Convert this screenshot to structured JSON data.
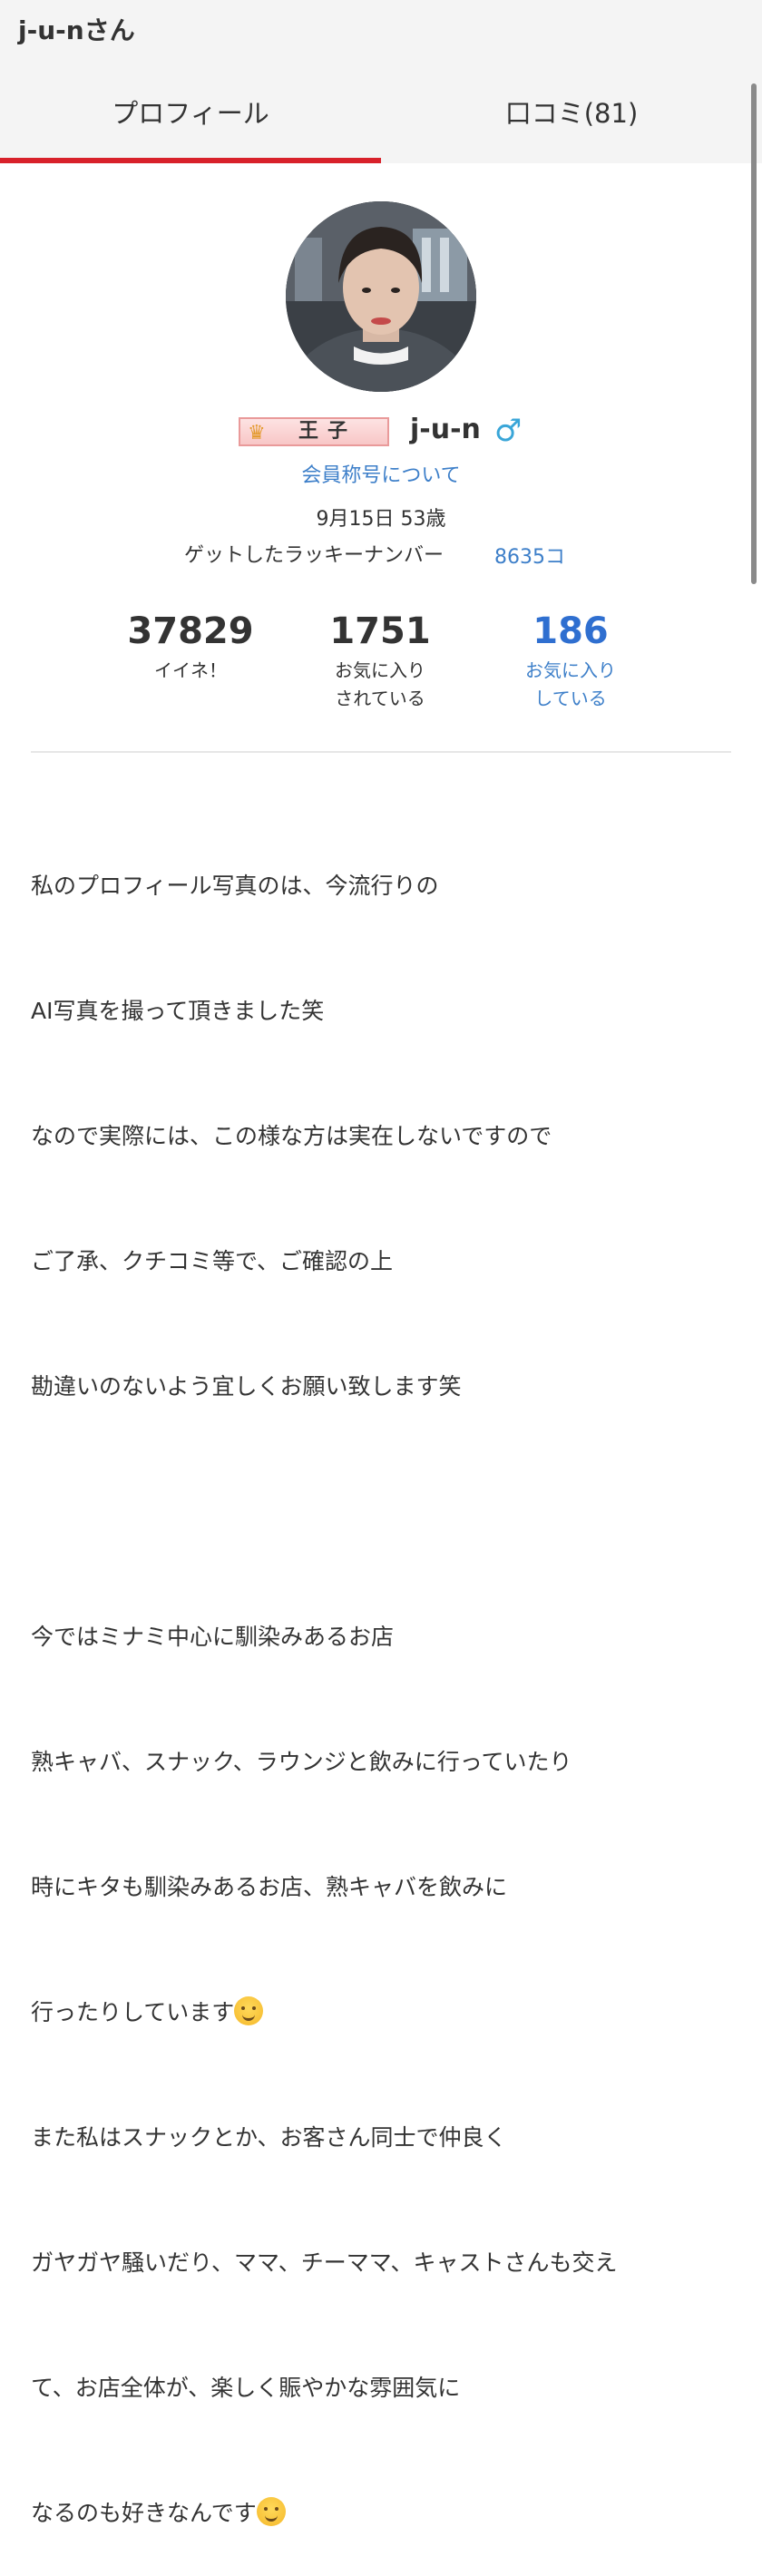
{
  "header": {
    "title": "j-u-nさん"
  },
  "tabs": [
    {
      "label": "プロフィール",
      "active": true
    },
    {
      "label": "口コミ(81)",
      "active": false
    }
  ],
  "profile": {
    "avatar_alt": "profile photo",
    "rank_badge": "王子",
    "username": "j-u-n",
    "gender_icon": "male-icon",
    "member_title_link": "会員称号について",
    "birth_age": "9月15日 53歳",
    "lucky_label": "ゲットしたラッキーナンバー",
    "lucky_value": "8635コ"
  },
  "stats": [
    {
      "value": "37829",
      "label_line1": "イイネ！",
      "label_line2": ""
    },
    {
      "value": "1751",
      "label_line1": "お気に入り",
      "label_line2": "されている"
    },
    {
      "value": "186",
      "label_line1": "お気に入り",
      "label_line2": "している"
    }
  ],
  "bio": {
    "lines": [
      "私のプロフィール写真のは、今流行りの",
      "AI写真を撮って頂きました笑",
      "なので実際には、この様な方は実在しないですので",
      "ご了承、クチコミ等で、ご確認の上",
      "勘違いのないよう宜しくお願い致します笑",
      "",
      "今ではミナミ中心に馴染みあるお店",
      "熟キャバ、スナック、ラウンジと飲みに行っていたり",
      "時にキタも馴染みあるお店、熟キャバを飲みに",
      "行ったりしています",
      "また私はスナックとか、お客さん同士で仲良く",
      "ガヤガヤ騒いだり、ママ、チーママ、キャストさんも交え",
      "て、お店全体が、楽しく賑やかな雰囲気に",
      "なるのも好きなんです"
    ]
  },
  "colors": {
    "accent_red": "#d8212a",
    "link_blue": "#3d7fc9",
    "gender_blue": "#3aa6d8"
  }
}
